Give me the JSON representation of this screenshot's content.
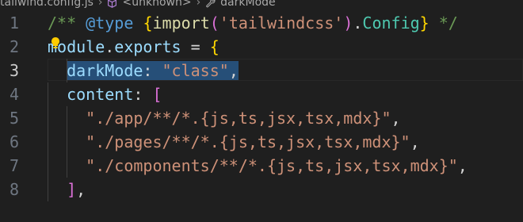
{
  "breadcrumb": {
    "file": "tailwind.config.js",
    "unknown": "<unknown>",
    "symbol": "darkMode"
  },
  "gutter": {
    "lines": [
      "1",
      "2",
      "3",
      "4",
      "5",
      "6",
      "7",
      "8"
    ],
    "active_line": "3"
  },
  "code": {
    "line1": {
      "open": "/** ",
      "tag": "@type",
      "space": " ",
      "brace_open": "{",
      "func": "import",
      "paren_open": "(",
      "module": "'tailwindcss'",
      "paren_close": ")",
      "dot": ".",
      "type": "Config",
      "brace_close": "}",
      "close": " */"
    },
    "line2": {
      "obj": "module",
      "dot": ".",
      "prop": "exports",
      "eq": " = ",
      "brace": "{"
    },
    "line3": {
      "key": "darkMode",
      "colon": ": ",
      "value": "\"class\"",
      "comma": ","
    },
    "line4": {
      "key": "content",
      "colon": ": ",
      "bracket": "["
    },
    "line5": {
      "value": "\"./app/**/*.{js,ts,jsx,tsx,mdx}\"",
      "comma": ","
    },
    "line6": {
      "value": "\"./pages/**/*.{js,ts,jsx,tsx,mdx}\"",
      "comma": ","
    },
    "line7": {
      "value": "\"./components/**/*.{js,ts,jsx,tsx,mdx}\"",
      "comma": ","
    },
    "line8": {
      "bracket": "]",
      "comma": ","
    }
  },
  "colors": {
    "background": "#1f1f1f",
    "selection": "#264f78",
    "comment": "#6a9955",
    "string": "#ce9178",
    "variable": "#9cdcfe",
    "keyword": "#569cd6",
    "type": "#4ec9b0",
    "brace": "#ffd700",
    "paren": "#da70d6",
    "function": "#dcdcaa"
  },
  "icons": {
    "breadcrumb_unknown": "cube-icon",
    "breadcrumb_symbol": "wrench-icon",
    "code_action": "lightbulb-icon"
  }
}
